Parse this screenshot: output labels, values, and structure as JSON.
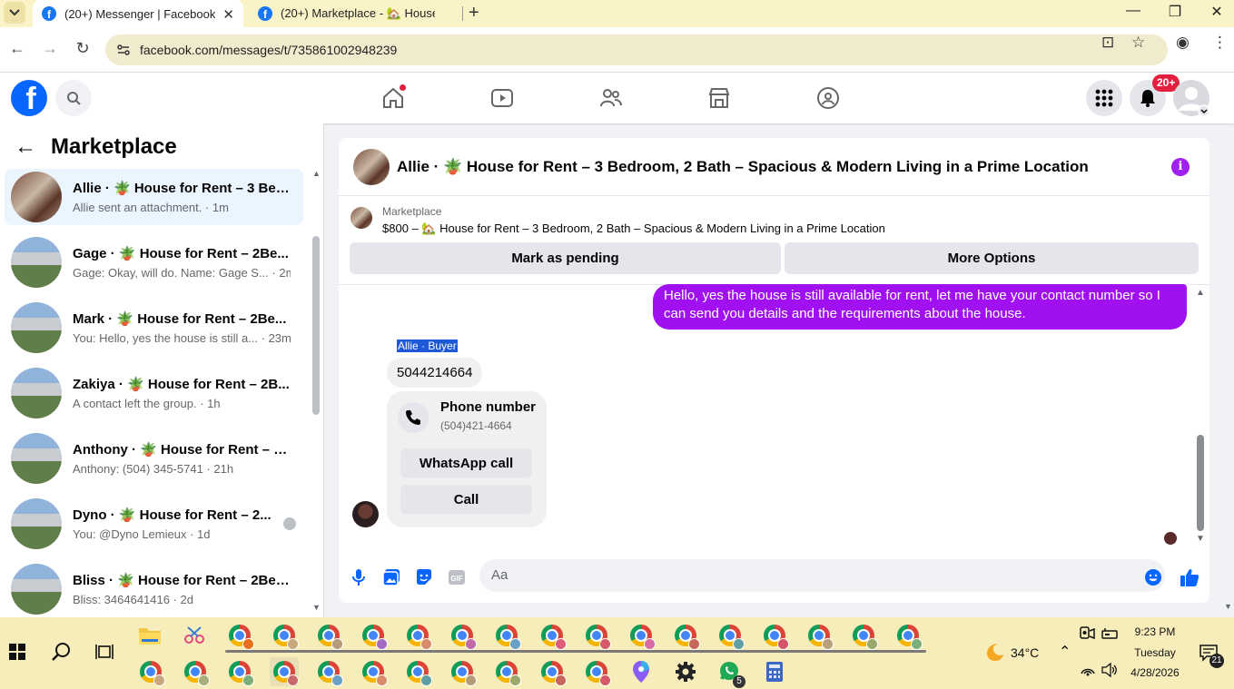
{
  "browser": {
    "tabs": [
      {
        "title": "(20+) Messenger | Facebook",
        "active": true
      },
      {
        "title": "(20+) Marketplace - 🏡 House",
        "active": false
      }
    ],
    "url": "facebook.com/messages/t/735861002948239"
  },
  "fb_nav": {
    "notifications_badge": "20+"
  },
  "left_panel": {
    "title": "Marketplace",
    "conversations": [
      {
        "name": "Allie · 🪴 House for Rent – 3 Bed...",
        "preview": "Allie sent an attachment. · 1m",
        "active": true
      },
      {
        "name": "Gage · 🪴 House for Rent – 2Be...",
        "preview": "Gage: Okay, will do. Name: Gage S... · 2m"
      },
      {
        "name": "Mark · 🪴 House for Rent – 2Be...",
        "preview": "You: Hello, yes the house is still a... · 23m"
      },
      {
        "name": "Zakiya · 🪴 House for Rent – 2B...",
        "preview": "A contact left the group. · 1h"
      },
      {
        "name": "Anthony · 🪴 House for Rent – 2...",
        "preview": "Anthony: (504) 345-5741 · 21h"
      },
      {
        "name": "Dyno · 🪴 House for Rent – 2...",
        "preview": "You: @Dyno Lemieux · 1d"
      },
      {
        "name": "Bliss · 🪴 House for Rent – 2Bed...",
        "preview": "Bliss: 3464641416 · 2d"
      }
    ]
  },
  "chat": {
    "title": "Allie · 🪴 House for Rent – 3 Bedroom, 2 Bath – Spacious & Modern Living in a Prime Location",
    "listing_source": "Marketplace",
    "listing_title": "$800 – 🏡 House for Rent – 3 Bedroom, 2 Bath – Spacious & Modern Living in a Prime Location",
    "mark_pending": "Mark as pending",
    "more_options": "More Options",
    "outgoing_message": "Hello, yes the house is still available for rent, let me have your contact number so I can send you details and the requirements about the house.",
    "sender_label": "Allie · Buyer",
    "incoming_message": "5044214664",
    "phone_card": {
      "title": "Phone number",
      "number": "(504)421-4664",
      "whatsapp": "WhatsApp call",
      "call": "Call"
    },
    "composer_placeholder": "Aa"
  },
  "taskbar": {
    "weather_temp": "34°C",
    "time": "9:23 PM",
    "day": "Tuesday",
    "date": "4/28/2026",
    "whatsapp_badge": "5",
    "notification_count": "21"
  },
  "colors": {
    "fb_blue": "#0866ff",
    "message_purple": "#a010f0",
    "tabstrip": "#fbf3c8",
    "taskbar": "#f6edbb"
  }
}
